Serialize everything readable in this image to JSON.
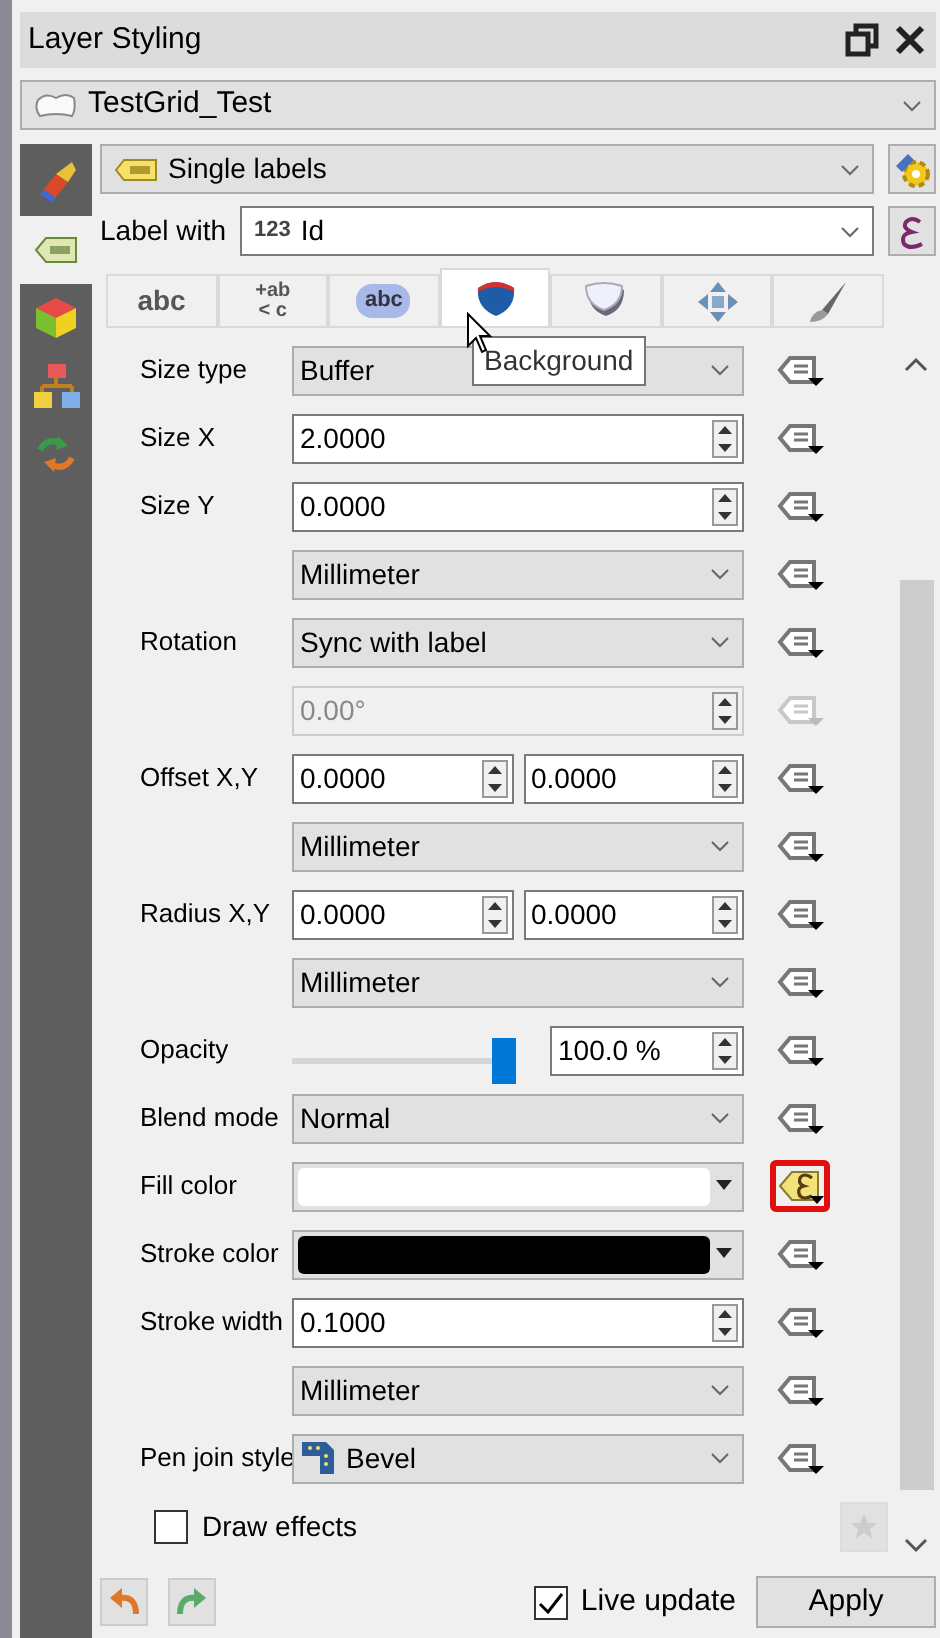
{
  "window": {
    "title": "Layer Styling"
  },
  "layer": {
    "name": "TestGrid_Test"
  },
  "renderer": {
    "value": "Single labels"
  },
  "label_with": {
    "label": "Label with",
    "type_badge": "123",
    "value": "Id"
  },
  "side_tabs": [
    {
      "kind": "symbology",
      "selected": false
    },
    {
      "kind": "labels",
      "selected": true
    },
    {
      "kind": "view3d",
      "selected": false
    },
    {
      "kind": "diagrams",
      "selected": false
    },
    {
      "kind": "history",
      "selected": false
    }
  ],
  "tabs": [
    {
      "kind": "text",
      "label": "abc",
      "selected": false
    },
    {
      "kind": "formatting",
      "lines": [
        "+ab",
        "< c"
      ],
      "selected": false
    },
    {
      "kind": "buffer",
      "label": "abc",
      "selected": false
    },
    {
      "kind": "background",
      "selected": true
    },
    {
      "kind": "shadow",
      "selected": false
    },
    {
      "kind": "placement",
      "selected": false
    },
    {
      "kind": "rendering",
      "selected": false
    }
  ],
  "tooltip": "Background",
  "rows": [
    {
      "kind": "combo",
      "label": "Size type",
      "value": "Buffer",
      "disabled": false,
      "override_active": false
    },
    {
      "kind": "spin",
      "label": "Size X",
      "value": "2.0000",
      "disabled": false,
      "override_active": false
    },
    {
      "kind": "spin",
      "label": "Size Y",
      "value": "0.0000",
      "disabled": false,
      "override_active": false
    },
    {
      "kind": "combo",
      "value": "Millimeter",
      "disabled": false,
      "override_active": false
    },
    {
      "kind": "combo",
      "label": "Rotation",
      "value": "Sync with label",
      "disabled": false,
      "override_active": false
    },
    {
      "kind": "spin",
      "value": "0.00°",
      "disabled": true,
      "override_active": false
    },
    {
      "kind": "spin2",
      "label": "Offset X,Y",
      "values": [
        "0.0000",
        "0.0000"
      ],
      "disabled": false,
      "override_active": false
    },
    {
      "kind": "combo",
      "value": "Millimeter",
      "disabled": false,
      "override_active": false
    },
    {
      "kind": "spin2",
      "label": "Radius X,Y",
      "values": [
        "0.0000",
        "0.0000"
      ],
      "disabled": false,
      "override_active": false
    },
    {
      "kind": "combo",
      "value": "Millimeter",
      "disabled": false,
      "override_active": false
    },
    {
      "kind": "slider",
      "label": "Opacity",
      "level": 1.0,
      "value": "100.0 %",
      "disabled": false,
      "override_active": false
    },
    {
      "kind": "combo",
      "label": "Blend mode",
      "value": "Normal",
      "disabled": false,
      "override_active": false
    },
    {
      "kind": "color",
      "label": "Fill color",
      "color": "#ffffff",
      "disabled": false,
      "override_active": true
    },
    {
      "kind": "color",
      "label": "Stroke color",
      "color": "#000000",
      "disabled": false,
      "override_active": false
    },
    {
      "kind": "spin",
      "label": "Stroke width",
      "value": "0.1000",
      "disabled": false,
      "override_active": false
    },
    {
      "kind": "combo",
      "value": "Millimeter",
      "disabled": false,
      "override_active": false
    },
    {
      "kind": "combo_icon",
      "label": "Pen join style",
      "value": "Bevel",
      "disabled": false,
      "override_active": false
    },
    {
      "kind": "checkbox",
      "label": "Draw effects",
      "checked": false,
      "disabled": false,
      "override_active": false
    }
  ],
  "live_update": {
    "label": "Live update",
    "checked": true
  },
  "apply": "Apply"
}
